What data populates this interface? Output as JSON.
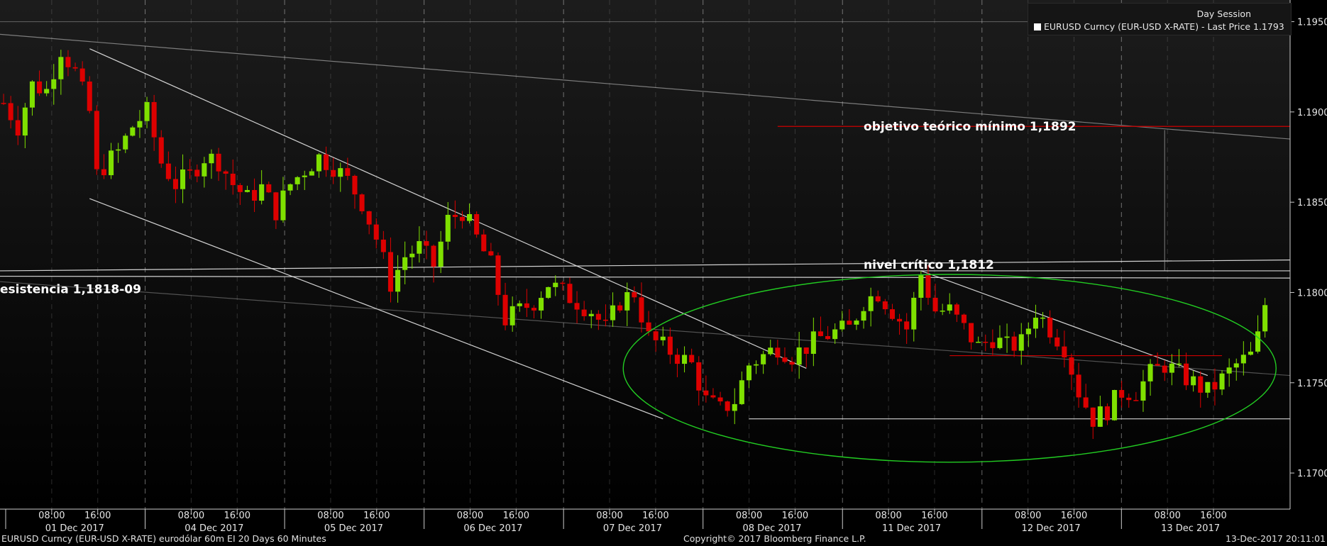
{
  "chart_data": {
    "type": "candlestick",
    "legend": {
      "session": "Day Session",
      "item": "EURUSD Curncy (EUR-USD X-RATE) - Last Price 1.1793",
      "swatch_color": "#ffffff"
    },
    "y_axis": {
      "min": 1.168,
      "max": 1.1962,
      "ticks": [
        "1.1700",
        "1.1750",
        "1.1800",
        "1.1850",
        "1.1900",
        "1.1950"
      ]
    },
    "x_axis": {
      "days": [
        {
          "date": "01 Dec 2017",
          "hours": [
            "08:00",
            "16:00"
          ]
        },
        {
          "date": "04 Dec 2017",
          "hours": [
            "08:00",
            "16:00"
          ]
        },
        {
          "date": "05 Dec 2017",
          "hours": [
            "08:00",
            "16:00"
          ]
        },
        {
          "date": "06 Dec 2017",
          "hours": [
            "08:00",
            "16:00"
          ]
        },
        {
          "date": "07 Dec 2017",
          "hours": [
            "08:00",
            "16:00"
          ]
        },
        {
          "date": "08 Dec 2017",
          "hours": [
            "08:00",
            "16:00"
          ]
        },
        {
          "date": "11 Dec 2017",
          "hours": [
            "08:00",
            "16:00"
          ]
        },
        {
          "date": "12 Dec 2017",
          "hours": [
            "08:00",
            "16:00"
          ]
        },
        {
          "date": "13 Dec 2017",
          "hours": [
            "08:00",
            "16:00"
          ]
        }
      ]
    },
    "price_path": [
      [
        0,
        1.1905
      ],
      [
        2,
        1.1892
      ],
      [
        4,
        1.1915
      ],
      [
        6,
        1.1912
      ],
      [
        8,
        1.1935
      ],
      [
        10,
        1.1922
      ],
      [
        12,
        1.19
      ],
      [
        13,
        1.1865
      ],
      [
        14,
        1.187
      ],
      [
        16,
        1.1878
      ],
      [
        18,
        1.1892
      ],
      [
        20,
        1.19
      ],
      [
        22,
        1.1872
      ],
      [
        24,
        1.186
      ],
      [
        26,
        1.1865
      ],
      [
        28,
        1.1875
      ],
      [
        30,
        1.1873
      ],
      [
        32,
        1.186
      ],
      [
        34,
        1.1852
      ],
      [
        36,
        1.1858
      ],
      [
        38,
        1.1845
      ],
      [
        40,
        1.186
      ],
      [
        42,
        1.1868
      ],
      [
        44,
        1.1875
      ],
      [
        46,
        1.187
      ],
      [
        48,
        1.1862
      ],
      [
        50,
        1.185
      ],
      [
        52,
        1.183
      ],
      [
        54,
        1.1805
      ],
      [
        56,
        1.182
      ],
      [
        58,
        1.1825
      ],
      [
        60,
        1.1815
      ],
      [
        62,
        1.184
      ],
      [
        64,
        1.1845
      ],
      [
        66,
        1.183
      ],
      [
        68,
        1.1815
      ],
      [
        70,
        1.1785
      ],
      [
        72,
        1.179
      ],
      [
        74,
        1.1795
      ],
      [
        76,
        1.1805
      ],
      [
        78,
        1.18
      ],
      [
        80,
        1.1795
      ],
      [
        82,
        1.179
      ],
      [
        84,
        1.178
      ],
      [
        86,
        1.1795
      ],
      [
        88,
        1.18
      ],
      [
        90,
        1.1775
      ],
      [
        92,
        1.177
      ],
      [
        94,
        1.1765
      ],
      [
        96,
        1.176
      ],
      [
        98,
        1.174
      ],
      [
        100,
        1.1735
      ],
      [
        102,
        1.174
      ],
      [
        104,
        1.176
      ],
      [
        106,
        1.1765
      ],
      [
        108,
        1.177
      ],
      [
        110,
        1.1765
      ],
      [
        112,
        1.177
      ],
      [
        114,
        1.1775
      ],
      [
        116,
        1.1778
      ],
      [
        118,
        1.178
      ],
      [
        120,
        1.1795
      ],
      [
        122,
        1.18
      ],
      [
        124,
        1.179
      ],
      [
        126,
        1.178
      ],
      [
        128,
        1.181
      ],
      [
        130,
        1.179
      ],
      [
        132,
        1.179
      ],
      [
        134,
        1.178
      ],
      [
        136,
        1.177
      ],
      [
        138,
        1.1775
      ],
      [
        140,
        1.177
      ],
      [
        142,
        1.1772
      ],
      [
        144,
        1.179
      ],
      [
        146,
        1.178
      ],
      [
        148,
        1.177
      ],
      [
        150,
        1.1745
      ],
      [
        152,
        1.173
      ],
      [
        154,
        1.1735
      ],
      [
        156,
        1.1745
      ],
      [
        158,
        1.1745
      ],
      [
        160,
        1.1755
      ],
      [
        162,
        1.176
      ],
      [
        164,
        1.1755
      ],
      [
        166,
        1.175
      ],
      [
        168,
        1.1745
      ],
      [
        170,
        1.1752
      ],
      [
        172,
        1.176
      ],
      [
        174,
        1.1765
      ],
      [
        175,
        1.1775
      ],
      [
        176,
        1.1793
      ]
    ],
    "annotations": [
      {
        "text": "objetivo teórico mínimo 1,1892",
        "level": 1.1892,
        "color": "#cc0000"
      },
      {
        "text": "nivel crítico 1,1812",
        "level": 1.1812,
        "color": "#ffffff"
      },
      {
        "text": "esistencia 1,1818-09",
        "level": 1.1809,
        "color": "#ffffff"
      }
    ],
    "colors": {
      "up": "#7fe000",
      "down": "#dd0000",
      "background": "#000000",
      "ellipse": "#22cc22",
      "trendline": "#ffffff",
      "grid": "#ffffff"
    }
  },
  "footer": {
    "left": "EURUSD Curncy (EUR-USD X-RATE) eurodólar 60m EI 20 Days 60 Minutes",
    "center": "Copyright© 2017 Bloomberg Finance L.P.",
    "right": "13-Dec-2017 20:11:01"
  }
}
